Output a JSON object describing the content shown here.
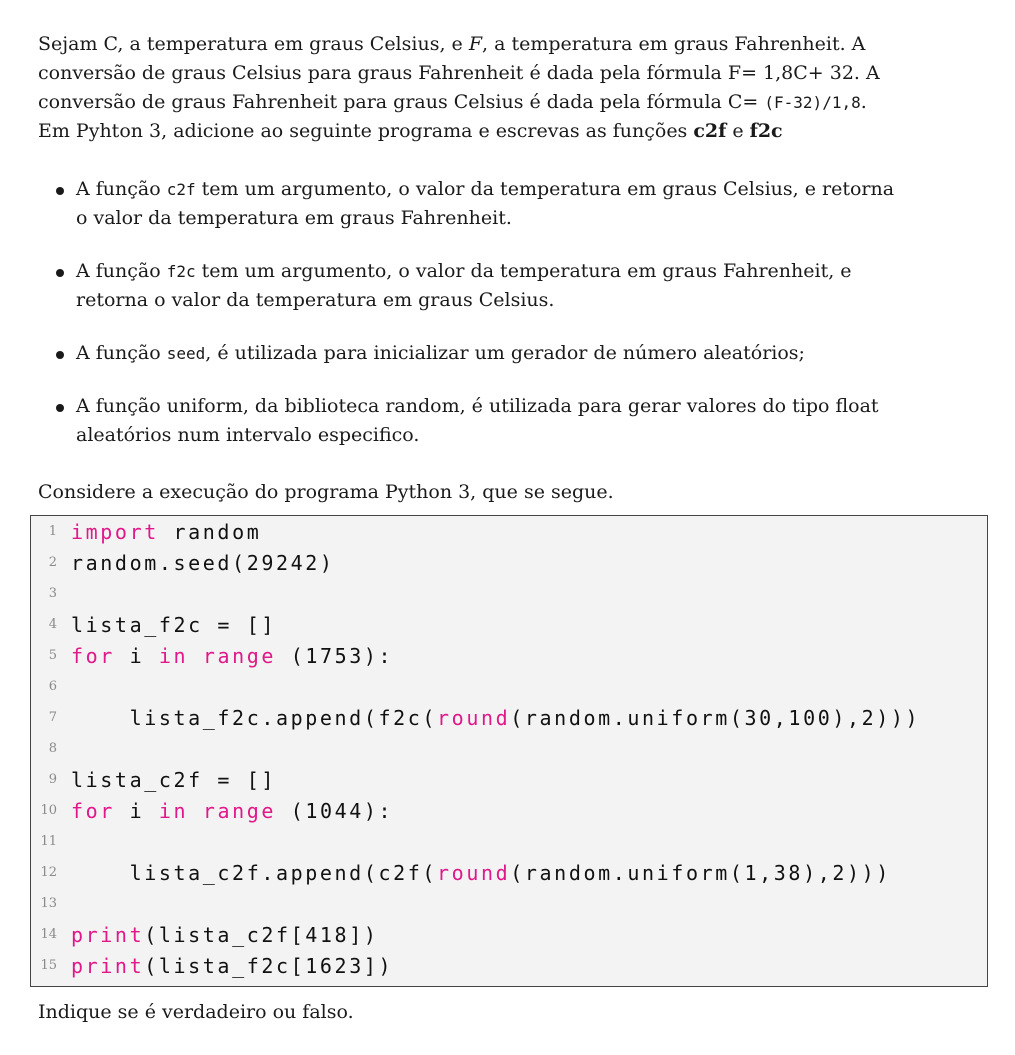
{
  "intro": {
    "l1_a": "Sejam C, a temperatura em graus Celsius, e ",
    "l1_F": "F",
    "l1_b": ", a temperatura em graus Fahrenheit.  A",
    "l2": "conversão de graus Celsius para graus Fahrenheit é dada pela fórmula F= 1,8C+ 32.  A",
    "l3_a": "conversão de graus Fahrenheit para graus Celsius é dada pela fórmula C= ",
    "l3_code": "(F-32)/1,8",
    "l3_b": ".",
    "l4_a": "Em Pyhton 3, adicione ao seguinte programa e escrevas as funções ",
    "l4_c2f": "c2f",
    "l4_mid": " e ",
    "l4_f2c": "f2c"
  },
  "bullets": [
    {
      "pre": "A função ",
      "code": "c2f",
      "post1": " tem um argumento, o valor da temperatura em graus Celsius, e retorna",
      "post2": "o valor da temperatura em graus Fahrenheit."
    },
    {
      "pre": "A função ",
      "code": "f2c",
      "post1": " tem um argumento, o valor da temperatura em graus Fahrenheit, e",
      "post2": "retorna o valor da temperatura em graus Celsius."
    },
    {
      "pre": "A função ",
      "code": "seed",
      "post1": ", é utilizada para inicializar um gerador de número aleatórios;",
      "post2": ""
    },
    {
      "pre": "A função uniform, da biblioteca random, é utilizada para gerar valores do tipo float",
      "code": "",
      "post1": "",
      "post2": "aleatórios num intervalo especifico."
    }
  ],
  "consider": "Considere a execução do programa Python 3, que se segue.",
  "code": {
    "line_numbers": [
      "1",
      "2",
      "3",
      "4",
      "5",
      "6",
      "7",
      "8",
      "9",
      "10",
      "11",
      "12",
      "13",
      "14",
      "15"
    ],
    "l1": {
      "kw": "import",
      "rest": " random"
    },
    "l2": "random.seed(29242)",
    "l4": "lista_f2c = []",
    "l5": {
      "kw1": "for",
      "mid1": " i ",
      "kw2": "in",
      "mid2": " ",
      "kw3": "range",
      "rest": " (1753):"
    },
    "l7": {
      "pre": "    lista_f2c.append(f2c(",
      "kw": "round",
      "rest": "(random.uniform(30,100),2)))"
    },
    "l9": "lista_c2f = []",
    "l10": {
      "kw1": "for",
      "mid1": " i ",
      "kw2": "in",
      "mid2": " ",
      "kw3": "range",
      "rest": " (1044):"
    },
    "l12": {
      "pre": "    lista_c2f.append(c2f(",
      "kw": "round",
      "rest": "(random.uniform(1,38),2)))"
    },
    "l14": {
      "kw": "print",
      "rest": "(lista_c2f[418])"
    },
    "l15": {
      "kw": "print",
      "rest": "(lista_f2c[1623])"
    }
  },
  "question": "Indique se é verdadeiro ou falso.",
  "colors": {
    "keyword": "#e0188a",
    "code_background": "#f3f3f3",
    "line_number": "#8a8a8a"
  }
}
